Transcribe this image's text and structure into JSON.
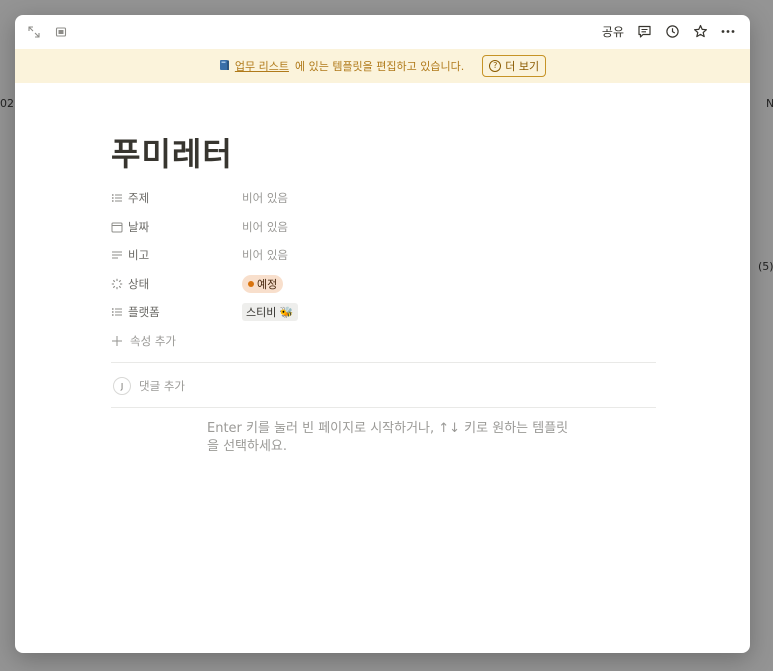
{
  "background": {
    "fragments": [
      "02",
      "N",
      "(5)"
    ]
  },
  "topbar": {
    "share_label": "공유",
    "icons": [
      "expand-icon",
      "side-peek-icon",
      "comment-icon",
      "history-icon",
      "favorite-star-icon",
      "more-options-icon"
    ]
  },
  "banner": {
    "database_link": "업무 리스트",
    "message": "에 있는 템플릿을 편집하고 있습니다.",
    "more_label": "더 보기",
    "help_glyph": "?"
  },
  "page": {
    "title": "푸미레터",
    "properties": [
      {
        "name": "주제",
        "icon": "list-icon",
        "value": "비어 있음"
      },
      {
        "name": "날짜",
        "icon": "calendar-icon",
        "value": "비어 있음"
      },
      {
        "name": "비고",
        "icon": "text-lines-icon",
        "value": "비어 있음"
      },
      {
        "name": "상태",
        "icon": "status-spinner-icon",
        "value": "예정",
        "color": "#f8dfcc",
        "dot_color": "#d9730d"
      },
      {
        "name": "플랫폼",
        "icon": "list-icon",
        "value": "스티비 🐝"
      }
    ],
    "add_property_label": "속성 추가",
    "comment": {
      "avatar_initial": "J",
      "label": "댓글 추가"
    },
    "template_hint": "Enter 키를 눌러 빈 페이지로 시작하거나, ↑↓ 키로 원하는 템플릿을 선택하세요."
  },
  "colors": {
    "banner_bg": "#fbf3db",
    "banner_text": "#b07a1a",
    "status_tag_bg": "#f8dfcc"
  }
}
